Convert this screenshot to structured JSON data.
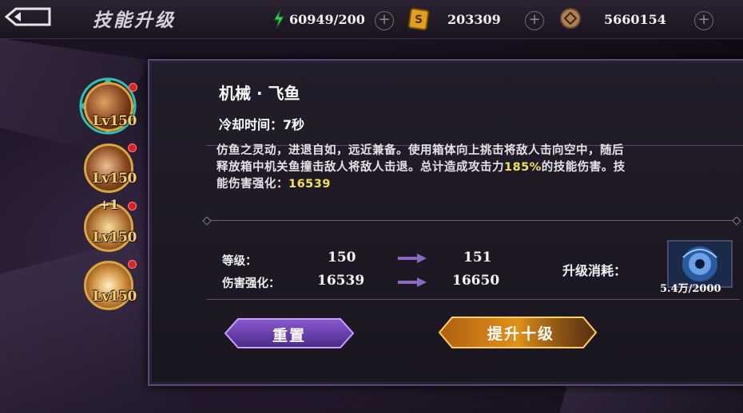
{
  "header": {
    "title": "技能升级",
    "stamina": "60949/200",
    "gold": "203309",
    "gems": "5660154",
    "plus_label": "+"
  },
  "skill_list": [
    {
      "level": "Lv150"
    },
    {
      "level": "Lv150"
    },
    {
      "level": "Lv150",
      "badge": "+1"
    },
    {
      "level": "Lv150"
    }
  ],
  "skill": {
    "name": "机械 · 飞鱼",
    "cooldown": "冷却时间：7秒",
    "desc_line1": "仿鱼之灵动，进退自如，远近兼备。使用箱体向上挑击将敌人击向空中，随后",
    "desc_line2_a": "释放箱中机关鱼撞击敌人将敌人击退。总计造成攻击力",
    "desc_line2_hl": "185%",
    "desc_line2_b": "的技能伤害。技",
    "desc_line3_a": "能伤害强化：",
    "desc_line3_hl": "16539"
  },
  "stats": {
    "level_label": "等级：",
    "level_from": "150",
    "level_to": "151",
    "dmg_label": "伤害强化：",
    "dmg_from": "16539",
    "dmg_to": "16650"
  },
  "cost": {
    "label": "升级消耗：",
    "value": "5.4万/2000"
  },
  "buttons": {
    "reset": "重置",
    "upgrade": "提升十级"
  },
  "colors": {
    "highlight": "#f0e35a",
    "panel_border": "#5a4a78",
    "level_gold": "#f5d070"
  }
}
